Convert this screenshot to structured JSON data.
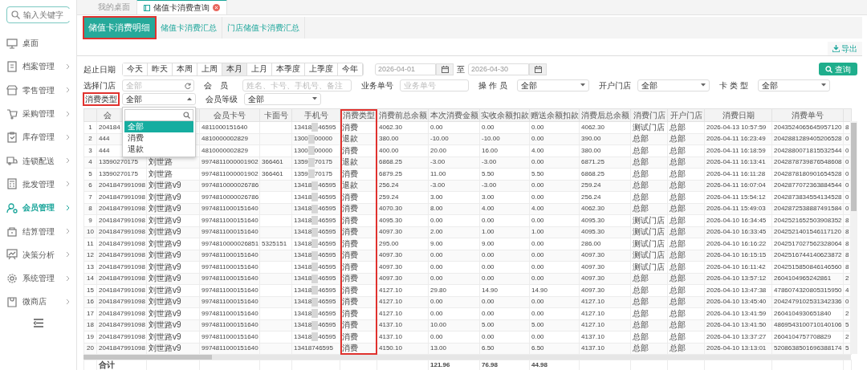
{
  "sidebar": {
    "search_placeholder": "输入关键字",
    "items": [
      {
        "label": "桌面",
        "selected": false,
        "has_arrow": false
      },
      {
        "label": "档案管理",
        "selected": false,
        "has_arrow": true
      },
      {
        "label": "零售管理",
        "selected": false,
        "has_arrow": true
      },
      {
        "label": "采购管理",
        "selected": false,
        "has_arrow": true
      },
      {
        "label": "库存管理",
        "selected": false,
        "has_arrow": true
      },
      {
        "label": "连锁配送",
        "selected": false,
        "has_arrow": true
      },
      {
        "label": "批发管理",
        "selected": false,
        "has_arrow": true
      },
      {
        "label": "会员管理",
        "selected": true,
        "has_arrow": true
      },
      {
        "label": "结算管理",
        "selected": false,
        "has_arrow": true
      },
      {
        "label": "决策分析",
        "selected": false,
        "has_arrow": true
      },
      {
        "label": "系统管理",
        "selected": false,
        "has_arrow": true
      },
      {
        "label": "微商店",
        "selected": false,
        "has_arrow": true
      }
    ]
  },
  "tabs": [
    {
      "label": "我的桌面",
      "selected": false,
      "closable": false
    },
    {
      "label": "储值卡消费查询",
      "selected": true,
      "closable": true
    }
  ],
  "subtabs": [
    {
      "label": "储值卡消费明细",
      "selected": true,
      "highlighted": true
    },
    {
      "label": "储值卡消费汇总",
      "selected": false,
      "highlighted": false
    },
    {
      "label": "门店储值卡消费汇总",
      "selected": false,
      "highlighted": false
    }
  ],
  "export_button": "导出",
  "query_button": "查询",
  "date_filter": {
    "label": "起止日期",
    "ranges": [
      {
        "label": "今天",
        "selected": false
      },
      {
        "label": "昨天",
        "selected": false
      },
      {
        "label": "本周",
        "selected": false
      },
      {
        "label": "上周",
        "selected": false
      },
      {
        "label": "本月",
        "selected": true
      },
      {
        "label": "上月",
        "selected": false
      },
      {
        "label": "本季度",
        "selected": false
      },
      {
        "label": "上季度",
        "selected": false
      },
      {
        "label": "今年",
        "selected": false
      }
    ],
    "start": "2026-04-01",
    "separator": "至",
    "end": "2026-04-30"
  },
  "filter_rows": [
    [
      {
        "label": "选择门店",
        "kind": "store",
        "placeholder": "全部"
      },
      {
        "label": "会　员",
        "kind": "text",
        "placeholder": "姓名、卡号、手机号、备注"
      },
      {
        "label": "业务单号",
        "kind": "text",
        "placeholder": "业务单号"
      },
      {
        "label": "操 作 员",
        "kind": "select",
        "value": "全部"
      },
      {
        "label": "开户门店",
        "kind": "select",
        "value": "全部"
      },
      {
        "label": "卡 类 型",
        "kind": "select",
        "value": "全部"
      }
    ],
    [
      {
        "label": "消费类型",
        "kind": "select",
        "value": "全部",
        "highlighted": true,
        "expanded": true,
        "options": [
          {
            "label": "全部",
            "selected": true
          },
          {
            "label": "消费",
            "selected": false
          },
          {
            "label": "退款",
            "selected": false
          }
        ]
      },
      {
        "label": "会员等级",
        "kind": "select",
        "value": "全部"
      }
    ]
  ],
  "table": {
    "type_column_highlighted": true,
    "columns": {
      "member": "会",
      "card": "会员卡号",
      "face": "卡面号",
      "phone": "手机号",
      "type": "消费类型",
      "before": "消费前总余额",
      "amount": "本次消费金额",
      "actual": "实收余额扣款",
      "gift": "赠送余额扣款",
      "after": "消费后总余额",
      "store": "消费门店",
      "open_store": "开户门店",
      "date": "消费日期",
      "order": "消费单号"
    },
    "rows": [
      {
        "no": "1",
        "member": "204184",
        "card": "4811000151640",
        "phone": [
          "13418",
          "46595"
        ],
        "type": "消费",
        "before": "4062.30",
        "amount": "0.00",
        "actual": "0.00",
        "gift": "0.00",
        "after": "4062.30",
        "store": "测试门店",
        "open_store": "总部",
        "date": "2026-04-13 10:57:59",
        "order": "2043524065645957120",
        "column_17": "8"
      },
      {
        "no": "2",
        "member": "444",
        "card": "4810000002829",
        "phone": [
          "1300",
          "00000"
        ],
        "type": "退款",
        "before": "380.00",
        "amount": "-10.00",
        "actual": "-10.00",
        "gift": "0.00",
        "after": "390.00",
        "store": "总部",
        "open_store": "总部",
        "date": "2026-04-11 16:23:49",
        "order": "2042881289405206528",
        "column_17": "0"
      },
      {
        "no": "3",
        "member": "444",
        "card": "4810000002829",
        "phone": [
          "1300",
          "00000"
        ],
        "type": "消费",
        "before": "400.00",
        "amount": "20.00",
        "actual": "16.00",
        "gift": "4.00",
        "after": "380.00",
        "store": "总部",
        "open_store": "总部",
        "date": "2026-04-11 16:18:59",
        "order": "2042880071815532544",
        "column_17": "0"
      },
      {
        "no": "4",
        "member": "13590270175",
        "name": "刘世路",
        "card": "9974811000001902",
        "face": "366461",
        "phone": [
          "1359",
          "70175"
        ],
        "type": "退款",
        "before": "6868.25",
        "amount": "-3.00",
        "actual": "-3.00",
        "gift": "0.00",
        "after": "6871.25",
        "store": "总部",
        "open_store": "总部",
        "date": "2026-04-11 16:13:41",
        "order": "2042878739876548608",
        "column_17": "0"
      },
      {
        "no": "5",
        "member": "13590270175",
        "name": "刘世路",
        "card": "9974811000001902",
        "face": "366461",
        "phone": [
          "1359",
          "70175"
        ],
        "type": "消费",
        "before": "6879.25",
        "amount": "11.00",
        "actual": "5.50",
        "gift": "5.50",
        "after": "6868.25",
        "store": "总部",
        "open_store": "总部",
        "date": "2026-04-11 16:11:28",
        "order": "2042878180901654528",
        "column_17": "0"
      },
      {
        "no": "6",
        "member": "2041847991098",
        "name": "刘世路v9",
        "card": "9974810000026786",
        "phone": [
          "13418",
          "46595"
        ],
        "type": "退款",
        "before": "256.24",
        "amount": "-3.00",
        "actual": "-3.00",
        "gift": "0.00",
        "after": "259.24",
        "store": "总部",
        "open_store": "总部",
        "date": "2026-04-11 16:07:04",
        "order": "2042877072363884544",
        "column_17": "0"
      },
      {
        "no": "7",
        "member": "2041847991098",
        "name": "刘世路v9",
        "card": "9974810000026786",
        "phone": [
          "13418",
          "46595"
        ],
        "type": "消费",
        "before": "259.24",
        "amount": "3.00",
        "actual": "3.00",
        "gift": "0.00",
        "after": "256.24",
        "store": "总部",
        "open_store": "总部",
        "date": "2026-04-11 15:54:12",
        "order": "2042873834554134528",
        "column_17": "0"
      },
      {
        "no": "8",
        "member": "2041847991098",
        "name": "刘世路v9",
        "card": "9974811000151640",
        "phone": [
          "13418",
          "46595"
        ],
        "type": "消费",
        "before": "4070.30",
        "amount": "8.00",
        "actual": "4.00",
        "gift": "4.00",
        "after": "4062.30",
        "store": "总部",
        "open_store": "总部",
        "date": "2026-04-11 15:49:03",
        "order": "2042872538887491584",
        "column_17": "0"
      },
      {
        "no": "9",
        "member": "2041847991098",
        "name": "刘世路v9",
        "card": "9974811000151640",
        "phone": [
          "13418",
          "46595"
        ],
        "type": "消费",
        "before": "4095.30",
        "amount": "0.00",
        "actual": "0.00",
        "gift": "0.00",
        "after": "4095.30",
        "store": "测试门店",
        "open_store": "总部",
        "date": "2026-04-10 16:34:45",
        "order": "2042521652503908352",
        "column_17": "8"
      },
      {
        "no": "10",
        "member": "2041847991098",
        "name": "刘世路v9",
        "card": "9974811000151640",
        "phone": [
          "13418",
          "46595"
        ],
        "type": "消费",
        "before": "4097.30",
        "amount": "2.00",
        "actual": "1.00",
        "gift": "1.00",
        "after": "4095.30",
        "store": "测试门店",
        "open_store": "总部",
        "date": "2026-04-10 16:33:45",
        "order": "2042521401546117120",
        "column_17": "8"
      },
      {
        "no": "11",
        "member": "2041847991098",
        "name": "刘世路v9",
        "card": "9974810000026851",
        "face": "5325151",
        "phone": [
          "13418",
          "46595"
        ],
        "type": "消费",
        "before": "295.00",
        "amount": "9.00",
        "actual": "9.00",
        "gift": "0.00",
        "after": "286.00",
        "store": "测试门店",
        "open_store": "总部",
        "date": "2026-04-10 16:16:22",
        "order": "2042517027562328064",
        "column_17": "8"
      },
      {
        "no": "12",
        "member": "2041847991098",
        "name": "刘世路v9",
        "card": "9974811000151640",
        "phone": [
          "13418",
          "46595"
        ],
        "type": "消费",
        "before": "4097.30",
        "amount": "0.00",
        "actual": "0.00",
        "gift": "0.00",
        "after": "4097.30",
        "store": "测试门店",
        "open_store": "总部",
        "date": "2026-04-10 16:15:15",
        "order": "2042516744140623872",
        "column_17": "8"
      },
      {
        "no": "13",
        "member": "2041847991098",
        "name": "刘世路v9",
        "card": "9974811000151640",
        "phone": [
          "13418",
          "46595"
        ],
        "type": "消费",
        "before": "4097.30",
        "amount": "0.00",
        "actual": "0.00",
        "gift": "0.00",
        "after": "4097.30",
        "store": "测试门店",
        "open_store": "总部",
        "date": "2026-04-10 16:11:42",
        "order": "2042515850846146560",
        "column_17": "8"
      },
      {
        "no": "14",
        "member": "2041847991098",
        "name": "刘世路v9",
        "card": "9974811000151640",
        "phone": [
          "13418",
          "46595"
        ],
        "type": "消费",
        "before": "4097.30",
        "amount": "0.00",
        "actual": "0.00",
        "gift": "0.00",
        "after": "4097.30",
        "store": "总部",
        "open_store": "总部",
        "date": "2026-04-10 13:57:12",
        "order": "2604104965242861",
        "column_17": "2"
      },
      {
        "no": "15",
        "member": "2041847991098",
        "name": "刘世路v9",
        "card": "9974811000151640",
        "phone": [
          "13418",
          "46595"
        ],
        "type": "消费",
        "before": "4127.10",
        "amount": "29.80",
        "actual": "14.90",
        "gift": "14.90",
        "after": "4097.30",
        "store": "总部",
        "open_store": "总部",
        "date": "2026-04-10 13:47:38",
        "order": "4786074320805315950",
        "column_17": "4"
      },
      {
        "no": "16",
        "member": "2041847991098",
        "name": "刘世路v9",
        "card": "9974811000151640",
        "phone": [
          "13418",
          "46595"
        ],
        "type": "消费",
        "before": "4127.10",
        "amount": "0.00",
        "actual": "0.00",
        "gift": "0.00",
        "after": "4127.10",
        "store": "总部",
        "open_store": "总部",
        "date": "2026-04-10 13:45:40",
        "order": "2042479102531342336",
        "column_17": "0"
      },
      {
        "no": "17",
        "member": "2041847991098",
        "name": "刘世路v9",
        "card": "9974811000151640",
        "phone": [
          "13418",
          "46595"
        ],
        "type": "消费",
        "before": "4127.10",
        "amount": "0.00",
        "actual": "0.00",
        "gift": "0.00",
        "after": "4127.10",
        "store": "总部",
        "open_store": "总部",
        "date": "2026-04-10 13:41:59",
        "order": "2604104930651840",
        "column_17": "2"
      },
      {
        "no": "18",
        "member": "2041847991098",
        "name": "刘世路v9",
        "card": "9974811000151640",
        "phone": [
          "13418",
          "46595"
        ],
        "type": "消费",
        "before": "4137.10",
        "amount": "10.00",
        "actual": "5.00",
        "gift": "5.00",
        "after": "4127.10",
        "store": "总部",
        "open_store": "总部",
        "date": "2026-04-10 13:41:50",
        "order": "4869543100710140106",
        "column_17": "5"
      },
      {
        "no": "19",
        "member": "2041847991098",
        "name": "刘世路v9",
        "card": "9974811000151640",
        "phone": [
          "13418",
          "46595"
        ],
        "type": "消费",
        "before": "4137.10",
        "amount": "0.00",
        "actual": "0.00",
        "gift": "0.00",
        "after": "4137.10",
        "store": "总部",
        "open_store": "总部",
        "date": "2026-04-10 13:37:27",
        "order": "2604104757708829",
        "column_17": "2"
      },
      {
        "no": "20",
        "member": "2041847991098",
        "name": "刘世路v9",
        "card": "9974811000151640",
        "phone": [
          "13418746595"
        ],
        "type": "消费",
        "before": "4150.10",
        "amount": "13.00",
        "actual": "6.50",
        "gift": "6.50",
        "after": "4137.10",
        "store": "总部",
        "open_store": "总部",
        "date": "2026-04-10 13:13:01",
        "order": "5208638501696388174",
        "column_17": "5"
      }
    ],
    "totals": {
      "member": "合计",
      "amount": "121.96",
      "actual": "76.98",
      "gift": "44.98"
    }
  }
}
